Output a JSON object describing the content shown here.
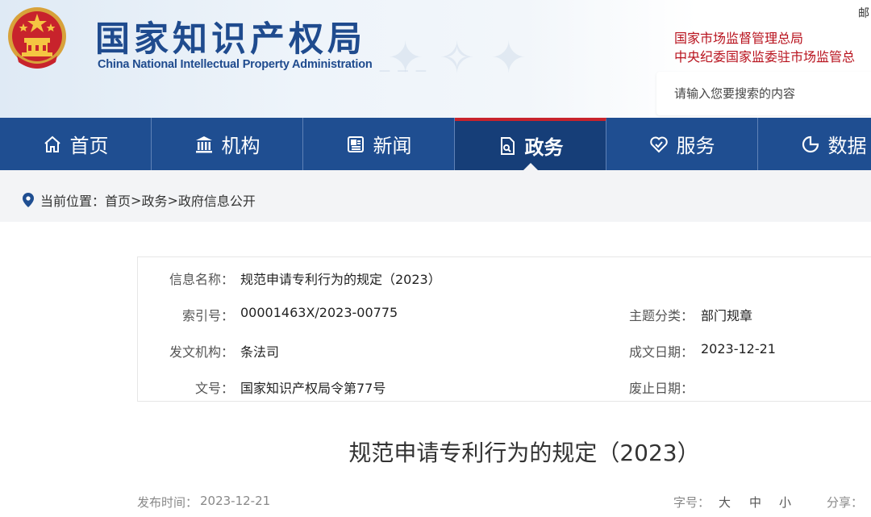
{
  "header": {
    "title_cn": "国家知识产权局",
    "title_en": "China National Intellectual Property Administration",
    "top_right_link": "邮",
    "org_links": [
      "国家市场监督管理总局",
      "中央纪委国家监委驻市场监管总"
    ],
    "search_placeholder": "请输入您要搜索的内容"
  },
  "nav": {
    "items": [
      {
        "label": "首页",
        "icon": "home-icon"
      },
      {
        "label": "机构",
        "icon": "building-icon"
      },
      {
        "label": "新闻",
        "icon": "newspaper-icon"
      },
      {
        "label": "政务",
        "icon": "document-icon",
        "active": true
      },
      {
        "label": "服务",
        "icon": "heart-icon"
      },
      {
        "label": "数据",
        "icon": "pie-chart-icon"
      }
    ],
    "color": "#1f4e91",
    "active_color": "#163e78",
    "accent": "#c8232c"
  },
  "breadcrumb": {
    "prefix": "当前位置：",
    "items": [
      "首页",
      "政务",
      "政府信息公开"
    ],
    "separator": ">"
  },
  "info": {
    "name_label": "信息名称：",
    "name_value": "规范申请专利行为的规定（2023）",
    "index_label": "索引号：",
    "index_value": "00001463X/2023-00775",
    "topic_label": "主题分类：",
    "topic_value": "部门规章",
    "issuer_label": "发文机构：",
    "issuer_value": "条法司",
    "date_label": "成文日期：",
    "date_value": "2023-12-21",
    "docno_label": "文号：",
    "docno_value": "国家知识产权局令第77号",
    "expiry_label": "废止日期：",
    "expiry_value": ""
  },
  "article": {
    "title": "规范申请专利行为的规定（2023）",
    "publish_label": "发布时间：",
    "publish_date": "2023-12-21",
    "font_label": "字号：",
    "font_sizes": [
      "大",
      "中",
      "小"
    ],
    "share_label": "分享："
  }
}
